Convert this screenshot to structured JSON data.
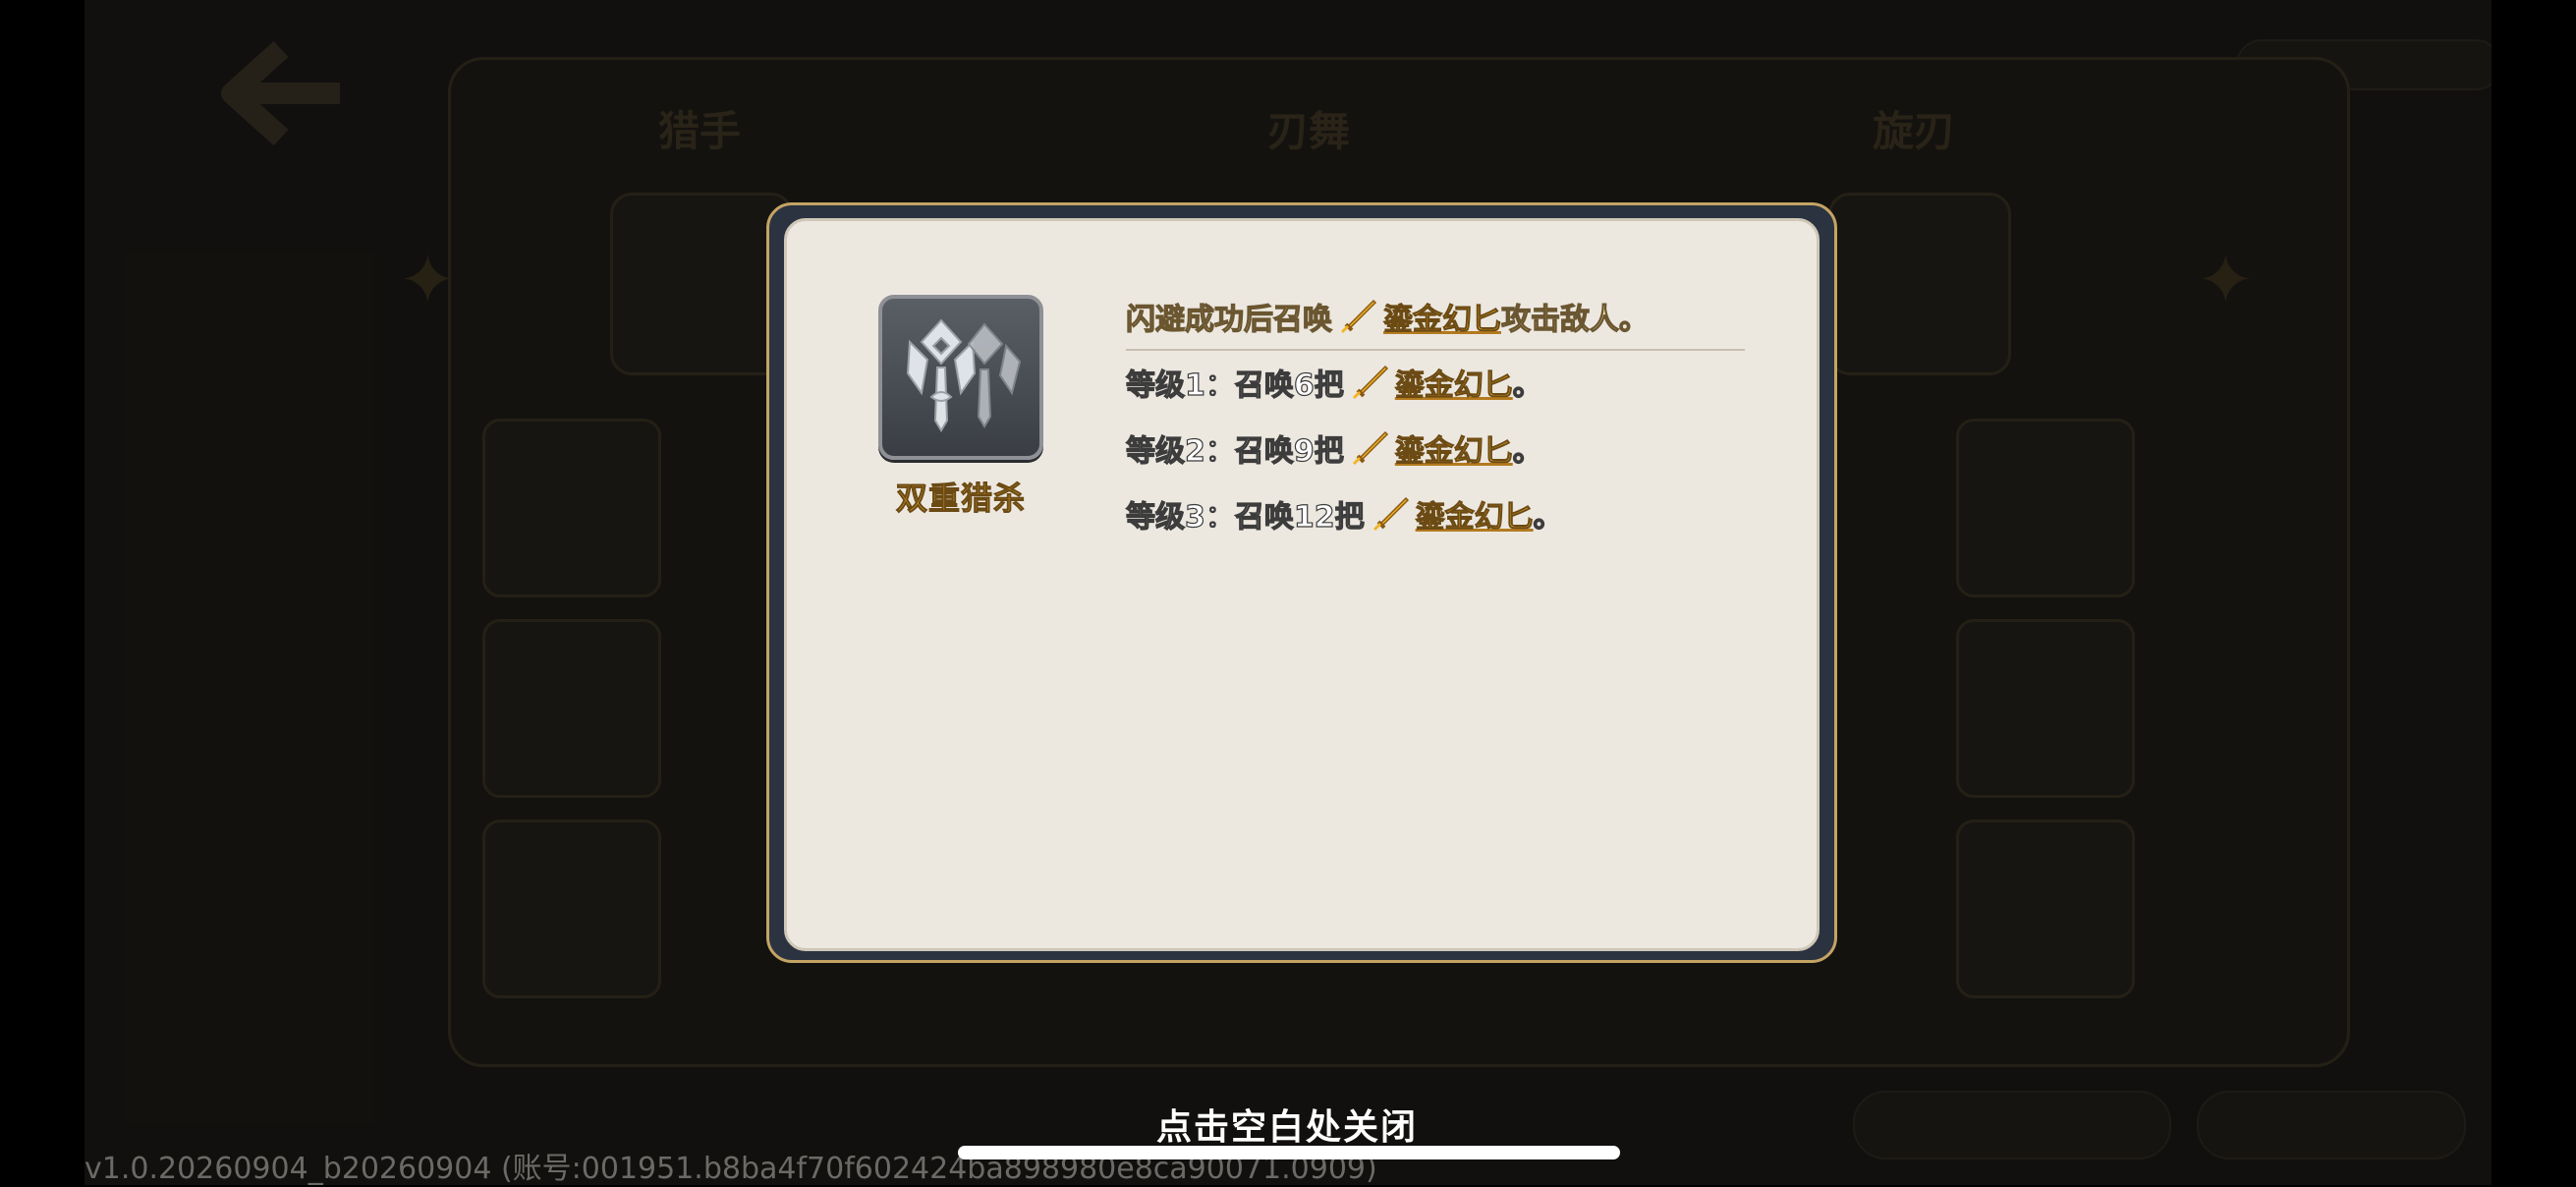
{
  "background": {
    "columns": [
      "猎手",
      "刃舞",
      "旋刃"
    ],
    "version": "v1.0.20260904_b20260904 (账号:001951.b8ba4f70f602424ba898980e8ca90071.0909)"
  },
  "dialog": {
    "skill": {
      "name": "双重猎杀",
      "icon": "twin-hunt-skill-icon"
    },
    "description": {
      "intro_prefix": "闪避成功后召唤",
      "weapon": "鎏金幻匕",
      "intro_suffix": "攻击敌人。"
    },
    "levels": [
      {
        "prefix": "等级1：召唤6把",
        "weapon": "鎏金幻匕",
        "suffix": "。"
      },
      {
        "prefix": "等级2：召唤9把",
        "weapon": "鎏金幻匕",
        "suffix": "。"
      },
      {
        "prefix": "等级3：召唤12把",
        "weapon": "鎏金幻匕",
        "suffix": "。"
      }
    ]
  },
  "close_hint": "点击空白处关闭",
  "colors": {
    "frame_gold": "#c4a464",
    "frame_dark": "#2b3340",
    "paper": "#ece8e0",
    "accent_gold": "#f3b427"
  }
}
